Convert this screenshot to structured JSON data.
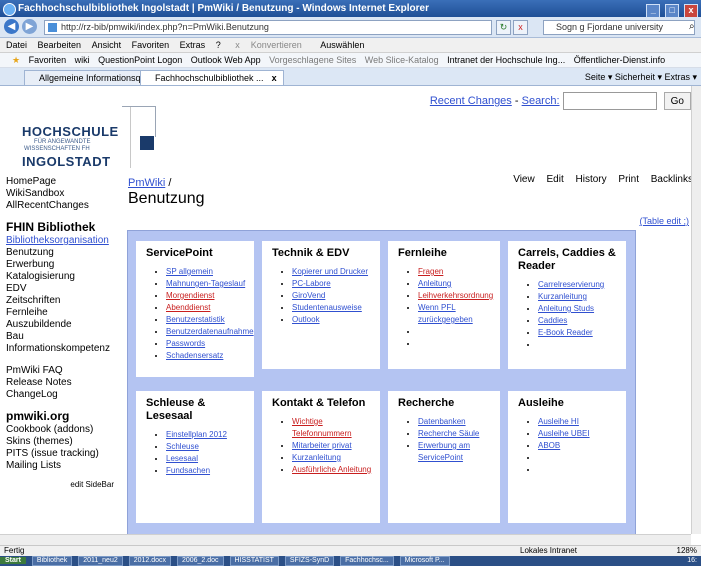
{
  "window": {
    "title": "Fachhochschulbibliothek Ingolstadt | PmWiki / Benutzung - Windows Internet Explorer",
    "minimize": "_",
    "restore": "□",
    "close": "x"
  },
  "address": {
    "back": "◀",
    "forward": "▶",
    "url": "http://rz-bib/pmwiki/index.php?n=PmWiki.Benutzung",
    "refresh": "↻",
    "stop": "x",
    "search_placeholder": "Sogn g Fjordane university",
    "go": "⌕"
  },
  "menubar": {
    "items": [
      "Datei",
      "Bearbeiten",
      "Ansicht",
      "Favoriten",
      "Extras",
      "?"
    ],
    "translate": "Konvertieren",
    "select": "Auswählen"
  },
  "favbar": {
    "favorites": "Favoriten",
    "items": [
      "wiki",
      "QuestionPoint Logon",
      "Outlook Web App",
      "Vorgeschlagene Sites",
      "Web Slice-Katalog",
      "Intranet der Hochschule Ing...",
      "Öffentlicher-Dienst.info"
    ]
  },
  "tabs": {
    "items": [
      {
        "label": "Allgemeine Informationsquellen"
      },
      {
        "label": "Fachhochschulbibliothek ..."
      }
    ],
    "close": "x",
    "tools": "Seite ▾   Sicherheit ▾   Extras ▾"
  },
  "logo": {
    "line1": "HOCHSCHULE",
    "line2": "FÜR ANGEWANDTE",
    "line3": "WISSENSCHAFTEN FH",
    "line4": "INGOLSTADT"
  },
  "header": {
    "recent_changes": "Recent Changes",
    "separator": "-",
    "search_label": "Search:",
    "go_button": "Go"
  },
  "sidebar": {
    "top": [
      "HomePage",
      "WikiSandbox",
      "AllRecentChanges"
    ],
    "fhin_heading": "FHIN Bibliothek",
    "fhin_items": [
      "Bibliotheksorganisation",
      "Benutzung",
      "Erwerbung",
      "Katalogisierung",
      "EDV",
      "Zeitschriften",
      "Fernleihe",
      "Auszubildende",
      "Bau",
      "Informationskompetenz"
    ],
    "misc_items": [
      "PmWiki FAQ",
      "Release Notes",
      "ChangeLog"
    ],
    "pmwiki_heading": "pmwiki.org",
    "pmwiki_items": [
      "Cookbook (addons)",
      "Skins (themes)",
      "PITS (issue tracking)",
      "Mailing Lists"
    ],
    "edit_sidebar": "edit SideBar"
  },
  "page": {
    "breadcrumb": "PmWiki",
    "breadcrumb_sep": "/",
    "title": "Benutzung",
    "actions": [
      "View",
      "Edit",
      "History",
      "Print",
      "Backlinks"
    ],
    "table_edit": "(Table edit ;)"
  },
  "cards": [
    {
      "title": "ServicePoint",
      "items": [
        {
          "label": "SP allgemein",
          "style": "link"
        },
        {
          "label": "Mahnungen-Tageslauf",
          "style": "link"
        },
        {
          "label": "Morgendienst",
          "style": "red"
        },
        {
          "label": "Abenddienst",
          "style": "red"
        },
        {
          "label": "Benutzerstatistik",
          "style": "link"
        },
        {
          "label": "Benutzerdatenaufnahme",
          "style": "link"
        },
        {
          "label": "Passwords",
          "style": "link"
        },
        {
          "label": "Schadensersatz",
          "style": "link"
        }
      ]
    },
    {
      "title": "Technik & EDV",
      "items": [
        {
          "label": "Kopierer und Drucker",
          "style": "link"
        },
        {
          "label": "PC-Labore",
          "style": "link"
        },
        {
          "label": "GiroVend",
          "style": "link"
        },
        {
          "label": "Studentenausweise",
          "style": "link"
        },
        {
          "label": "Outlook",
          "style": "link"
        }
      ]
    },
    {
      "title": "Fernleihe",
      "items": [
        {
          "label": "Fragen",
          "style": "red"
        },
        {
          "label": "Anleitung",
          "style": "link"
        },
        {
          "label": "Leihverkehrsordnung",
          "style": "red"
        },
        {
          "label": "Wenn PFL zurückgegeben",
          "style": "link"
        },
        {
          "label": "",
          "style": "empty"
        },
        {
          "label": "",
          "style": "empty"
        }
      ]
    },
    {
      "title": "Carrels, Caddies & Reader",
      "items": [
        {
          "label": "Carrelreservierung",
          "style": "link"
        },
        {
          "label": "Kurzanleitung",
          "style": "link"
        },
        {
          "label": "Anleitung Studs",
          "style": "link"
        },
        {
          "label": "Caddies",
          "style": "link"
        },
        {
          "label": "E-Book Reader",
          "style": "link"
        },
        {
          "label": "",
          "style": "empty"
        }
      ]
    },
    {
      "title": "Schleuse & Lesesaal",
      "items": [
        {
          "label": "Einstellplan 2012",
          "style": "link"
        },
        {
          "label": "Schleuse",
          "style": "link"
        },
        {
          "label": "Lesesaal",
          "style": "link"
        },
        {
          "label": "Fundsachen",
          "style": "link"
        }
      ]
    },
    {
      "title": "Kontakt & Telefon",
      "items": [
        {
          "label": "Wichtige Telefonnummern",
          "style": "red"
        },
        {
          "label": "Mitarbeiter privat",
          "style": "link"
        },
        {
          "label": "Kurzanleitung",
          "style": "link"
        },
        {
          "label": "Ausführliche Anleitung",
          "style": "red"
        }
      ]
    },
    {
      "title": "Recherche",
      "items": [
        {
          "label": "Datenbanken",
          "style": "link"
        },
        {
          "label": "Recherche Säule",
          "style": "link"
        },
        {
          "label": "Erwerbung am ServicePoint",
          "style": "link"
        }
      ]
    },
    {
      "title": "Ausleihe",
      "items": [
        {
          "label": "Ausleihe HI",
          "style": "link"
        },
        {
          "label": "Ausleihe UBEI",
          "style": "link"
        },
        {
          "label": "ABOB",
          "style": "link"
        },
        {
          "label": "",
          "style": "empty"
        },
        {
          "label": "",
          "style": "empty"
        }
      ]
    }
  ],
  "status": {
    "left": "Fertig",
    "zone": "Lokales Intranet",
    "zoom": "128%"
  },
  "taskbar": {
    "start": "Start",
    "items": [
      "Bibliothek",
      "2011_neu2",
      "2012.docx",
      "2006_2.doc",
      "HISSTATIST",
      "SFIZS-SynD",
      "Fachhochsc...",
      "Microsoft P..."
    ],
    "clock": "16:"
  }
}
